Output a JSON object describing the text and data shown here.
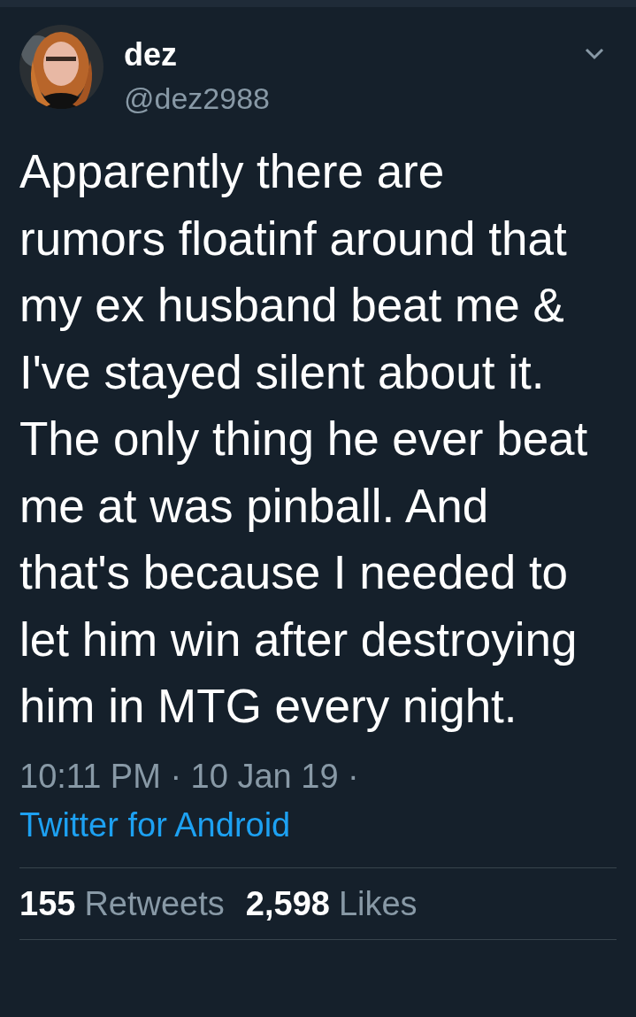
{
  "tweet": {
    "author": {
      "name": "dez",
      "handle": "@dez2988"
    },
    "text": "Apparently there are rumors floatinf around that my ex husband beat me & I've stayed silent about it. The only thing he ever beat me at was pinball. And that's because I needed to let him win after destroying him in MTG every night.",
    "time": "10:11 PM",
    "separator": "·",
    "date": "10 Jan 19",
    "source": "Twitter for Android",
    "stats": [
      {
        "count": "155",
        "label": "Retweets"
      },
      {
        "count": "2,598",
        "label": "Likes"
      }
    ]
  }
}
